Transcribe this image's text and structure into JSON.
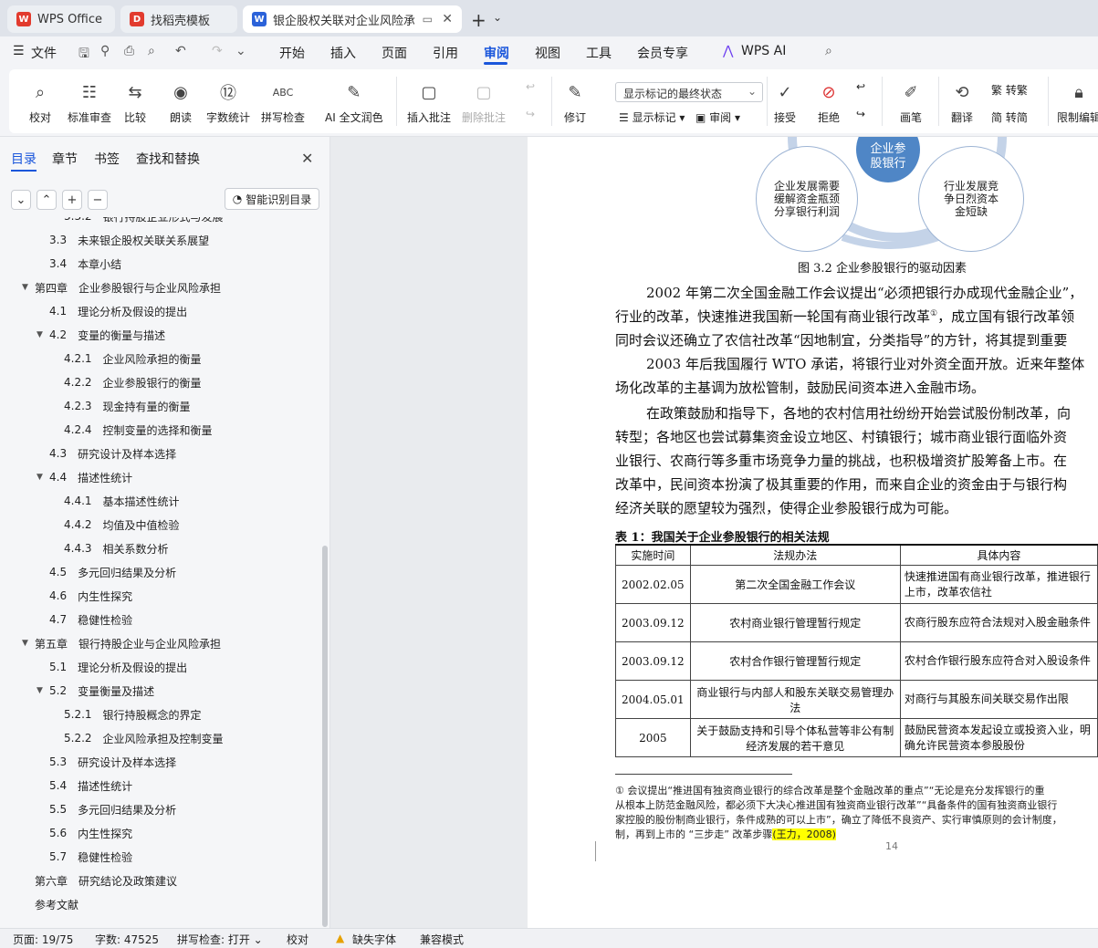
{
  "tabs": [
    {
      "title": "WPS Office"
    },
    {
      "title": "找稻壳模板"
    },
    {
      "title": "银企股权关联对企业风险承担的影响研究"
    }
  ],
  "menu": [
    "文件",
    "开始",
    "插入",
    "页面",
    "引用",
    "审阅",
    "视图",
    "工具",
    "会员专享",
    "WPS AI"
  ],
  "ribbon": {
    "buttons": [
      "校对",
      "标准审查",
      "比较",
      "朗读",
      "字数统计",
      "拼写检查",
      "AI 全文润色",
      "插入批注",
      "删除批注",
      "修订",
      "显示标记",
      "审阅",
      "接受",
      "拒绝",
      "画笔",
      "翻译",
      "转繁",
      "转简",
      "限制编辑"
    ],
    "markup_mode": "显示标记的最终状态"
  },
  "sidebar": {
    "tabs": [
      "目录",
      "章节",
      "书签",
      "查找和替换"
    ],
    "smart_button": "智能识别目录",
    "toc": [
      {
        "num": "3.3.2",
        "text": "银行持股企业形式与发展"
      },
      {
        "num": "3.3",
        "text": "未来银企股权关联关系展望"
      },
      {
        "num": "3.4",
        "text": "本章小结"
      },
      {
        "num": "第四章",
        "text": "企业参股银行与企业风险承担"
      },
      {
        "num": "4.1",
        "text": "理论分析及假设的提出"
      },
      {
        "num": "4.2",
        "text": "变量的衡量与描述"
      },
      {
        "num": "4.2.1",
        "text": "企业风险承担的衡量"
      },
      {
        "num": "4.2.2",
        "text": "企业参股银行的衡量"
      },
      {
        "num": "4.2.3",
        "text": "现金持有量的衡量"
      },
      {
        "num": "4.2.4",
        "text": "控制变量的选择和衡量"
      },
      {
        "num": "4.3",
        "text": "研究设计及样本选择"
      },
      {
        "num": "4.4",
        "text": "描述性统计"
      },
      {
        "num": "4.4.1",
        "text": "基本描述性统计"
      },
      {
        "num": "4.4.2",
        "text": "均值及中值检验"
      },
      {
        "num": "4.4.3",
        "text": "相关系数分析"
      },
      {
        "num": "4.5",
        "text": "多元回归结果及分析"
      },
      {
        "num": "4.6",
        "text": "内生性探究"
      },
      {
        "num": "4.7",
        "text": "稳健性检验"
      },
      {
        "num": "第五章",
        "text": "银行持股企业与企业风险承担"
      },
      {
        "num": "5.1",
        "text": "理论分析及假设的提出"
      },
      {
        "num": "5.2",
        "text": "变量衡量及描述"
      },
      {
        "num": "5.2.1",
        "text": "银行持股概念的界定"
      },
      {
        "num": "5.2.2",
        "text": "企业风险承担及控制变量"
      },
      {
        "num": "5.3",
        "text": "研究设计及样本选择"
      },
      {
        "num": "5.4",
        "text": "描述性统计"
      },
      {
        "num": "5.5",
        "text": "多元回归结果及分析"
      },
      {
        "num": "5.6",
        "text": "内生性探究"
      },
      {
        "num": "5.7",
        "text": "稳健性检验"
      },
      {
        "num": "第六章",
        "text": "研究结论及政策建议"
      },
      {
        "num": "",
        "text": "参考文献"
      }
    ]
  },
  "document": {
    "diagram": {
      "center": "企业参股银行",
      "left": "企业发展需要缓解资金瓶颈分享银行利润",
      "right": "行业发展竞争日烈资本金短缺"
    },
    "figure_caption": "图 3.2 企业参股银行的驱动因素",
    "paragraph_lines": [
      "2002 年第二次全国金融工作会议提出“必须把银行办成现代金融企业”，",
      "行业的改革，快速推进我国新一轮国有商业银行改革",
      "，成立国有银行改革领",
      "同时会议还确立了农信社改革“因地制宜，分类指导”的方针，将其提到重要",
      "2003 年后我国履行 WTO 承诺，将银行业对外资全面开放。近来年整体",
      "场化改革的主基调为放松管制，鼓励民间资本进入金融市场。",
      "在政策鼓励和指导下，各地的农村信用社纷纷开始尝试股份制改革，向",
      "转型；各地区也尝试募集资金设立地区、村镇银行；城市商业银行面临外资",
      "业银行、农商行等多重市场竞争力量的挑战，也积极增资扩股筹备上市。在",
      "改革中，民间资本扮演了极其重要的作用，而来自企业的资金由于与银行构",
      "经济关联的愿望较为强烈，使得企业参股银行成为可能。"
    ],
    "footnote_mark": "①",
    "table_title": "表 1：我国关于企业参股银行的相关法规",
    "table_headers": [
      "实施时间",
      "法规办法",
      "具体内容"
    ],
    "table_rows": [
      {
        "date": "2002.02.05",
        "law": "第二次全国金融工作会议",
        "content": "快速推进国有商业银行改革，推进银行上市，改革农信社"
      },
      {
        "date": "2003.09.12",
        "law": "农村商业银行管理暂行规定",
        "content": "农商行股东应符合法规对入股金融条件"
      },
      {
        "date": "2003.09.12",
        "law": "农村合作银行管理暂行规定",
        "content": "农村合作银行股东应符合对入股设条件"
      },
      {
        "date": "2004.05.01",
        "law": "商业银行与内部人和股东关联交易管理办法",
        "content": "对商行与其股东间关联交易作出限"
      },
      {
        "date": "2005",
        "law": "关于鼓励支持和引导个体私营等非公有制经济发展的若干意见",
        "content": "鼓励民营资本发起设立或投资入业，明确允许民营资本参股股份"
      }
    ],
    "footnote_lines": [
      "① 会议提出“推进国有独资商业银行的综合改革是整个金融改革的重点”“无论是充分发挥银行的重",
      "从根本上防范金融风险，都必须下大决心推进国有独资商业银行改革”“具备条件的国有独资商业银行",
      "家控股的股份制商业银行，条件成熟的可以上市”，确立了降低不良资产、实行审慎原则的会计制度，",
      "制，再到上市的 “三步走” 改革步骤",
      "(王力，2008)"
    ],
    "page_number": "14"
  },
  "status": {
    "page": "页面: 19/75",
    "words": "字数: 47525",
    "spell": "拼写检查: 打开",
    "proof": "校对",
    "missing_font": "缺失字体",
    "compat": "兼容模式"
  }
}
